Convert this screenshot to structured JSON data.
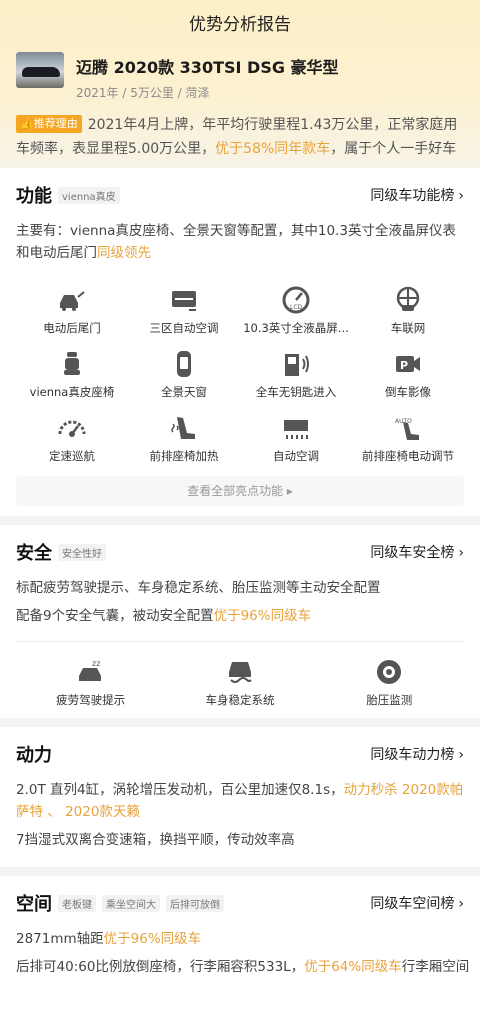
{
  "page_title": "优势分析报告",
  "car": {
    "name": "迈腾 2020款 330TSI DSG 豪华型",
    "year": "2021年",
    "mileage": "5万公里",
    "city": "菏泽",
    "sep": " / "
  },
  "reason": {
    "tag": "推荐理由",
    "text_1": "2021年4月上牌，年平均行驶里程1.43万公里，正常家庭用车频率，表显里程5.00万公里，",
    "highlight": "优于58%同年款车",
    "text_2": "，属于个人一手好车"
  },
  "function": {
    "title": "功能",
    "chip": "vienna真皮",
    "rank": "同级车功能榜",
    "desc_1": "主要有：vienna真皮座椅、全景天窗等配置，其中10.3英寸全液晶屏仪表和电动后尾门",
    "desc_hl": "同级领先",
    "features": [
      {
        "label": "电动后尾门",
        "icon": "power-tailgate-icon"
      },
      {
        "label": "三区自动空调",
        "icon": "tri-zone-ac-icon"
      },
      {
        "label": "10.3英寸全液晶屏...",
        "icon": "lcd-gauge-icon"
      },
      {
        "label": "车联网",
        "icon": "connected-car-icon"
      },
      {
        "label": "vienna真皮座椅",
        "icon": "leather-seat-icon"
      },
      {
        "label": "全景天窗",
        "icon": "panoramic-sunroof-icon"
      },
      {
        "label": "全车无钥匙进入",
        "icon": "keyless-entry-icon"
      },
      {
        "label": "倒车影像",
        "icon": "reverse-camera-icon"
      },
      {
        "label": "定速巡航",
        "icon": "cruise-control-icon"
      },
      {
        "label": "前排座椅加热",
        "icon": "seat-heating-icon"
      },
      {
        "label": "自动空调",
        "icon": "auto-ac-icon"
      },
      {
        "label": "前排座椅电动调节",
        "icon": "power-seat-icon"
      }
    ],
    "more": "查看全部亮点功能 ▸"
  },
  "safety": {
    "title": "安全",
    "chip": "安全性好",
    "rank": "同级车安全榜",
    "desc_1": "标配疲劳驾驶提示、车身稳定系统、胎压监测等主动安全配置",
    "desc_2": "配备9个安全气囊，被动安全配置",
    "desc_hl": "优于96%同级车",
    "features": [
      {
        "label": "疲劳驾驶提示",
        "icon": "fatigue-alert-icon"
      },
      {
        "label": "车身稳定系统",
        "icon": "stability-control-icon"
      },
      {
        "label": "胎压监测",
        "icon": "tire-pressure-icon"
      }
    ]
  },
  "power": {
    "title": "动力",
    "rank": "同级车动力榜",
    "desc_1": "2.0T 直列4缸，涡轮增压发动机，百公里加速仅8.1s，",
    "desc_hl": "动力秒杀 2020款帕萨特 、 2020款天籁",
    "desc_2": "7挡湿式双离合变速箱，换挡平顺，传动效率高"
  },
  "space": {
    "title": "空间",
    "chips": [
      "老板键",
      "乘坐空间大",
      "后排可放倒"
    ],
    "rank": "同级车空间榜",
    "desc_1": "2871mm轴距",
    "desc_1_hl": "优于96%同级车",
    "desc_2": "后排可40:60比例放倒座椅，行李厢容积533L，",
    "desc_2_hl": "优于64%同级车",
    "desc_2_tail": "行李厢空间"
  },
  "colors": {
    "accent": "#e8a23b",
    "tag": "#f5a623",
    "icon": "#5a5a5a"
  }
}
